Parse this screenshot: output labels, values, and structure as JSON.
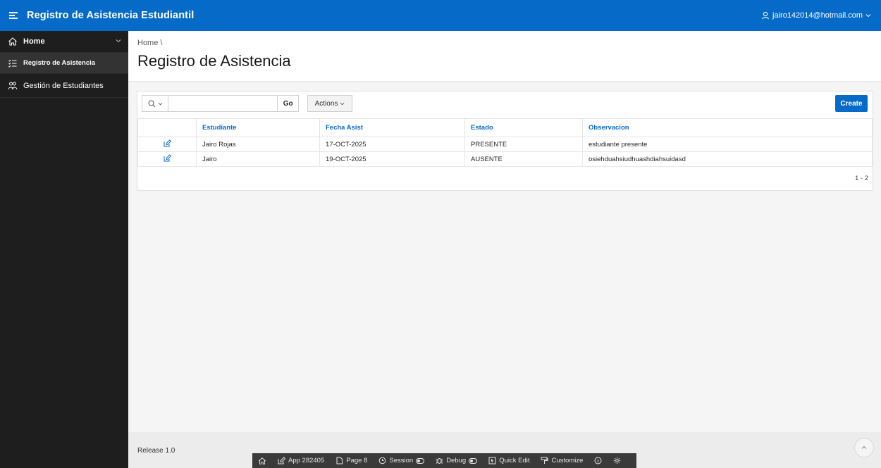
{
  "header": {
    "app_title": "Registro de Asistencia Estudiantil",
    "user_email": "jairo142014@hotmail.com"
  },
  "sidebar": {
    "items": [
      {
        "label": "Home",
        "icon": "home-icon"
      },
      {
        "label": "Registro de Asistencia",
        "icon": "list-icon"
      },
      {
        "label": "Gestión de Estudiantes",
        "icon": "users-icon"
      }
    ]
  },
  "page": {
    "breadcrumb": "Home \\",
    "title": "Registro de Asistencia"
  },
  "toolbar": {
    "search_value": "",
    "go_label": "Go",
    "actions_label": "Actions",
    "create_label": "Create"
  },
  "report": {
    "columns": [
      "Estudiante",
      "Fecha Asist",
      "Estado",
      "Observacion"
    ],
    "rows": [
      [
        "Jairo Rojas",
        "17-OCT-2025",
        "PRESENTE",
        "estudiante presente"
      ],
      [
        "Jairo",
        "19-OCT-2025",
        "AUSENTE",
        "osiehduahsiudhuashdiahsuidasd"
      ]
    ],
    "pagination": "1 - 2"
  },
  "footer": {
    "release": "Release 1.0"
  },
  "devbar": {
    "app": "App 282405",
    "page": "Page 8",
    "session": "Session",
    "debug": "Debug",
    "quick_edit": "Quick Edit",
    "customize": "Customize"
  },
  "colors": {
    "accent": "#056ac8",
    "sidebar_bg": "#1e1e1e",
    "devbar_bg": "#3a3a3a"
  }
}
